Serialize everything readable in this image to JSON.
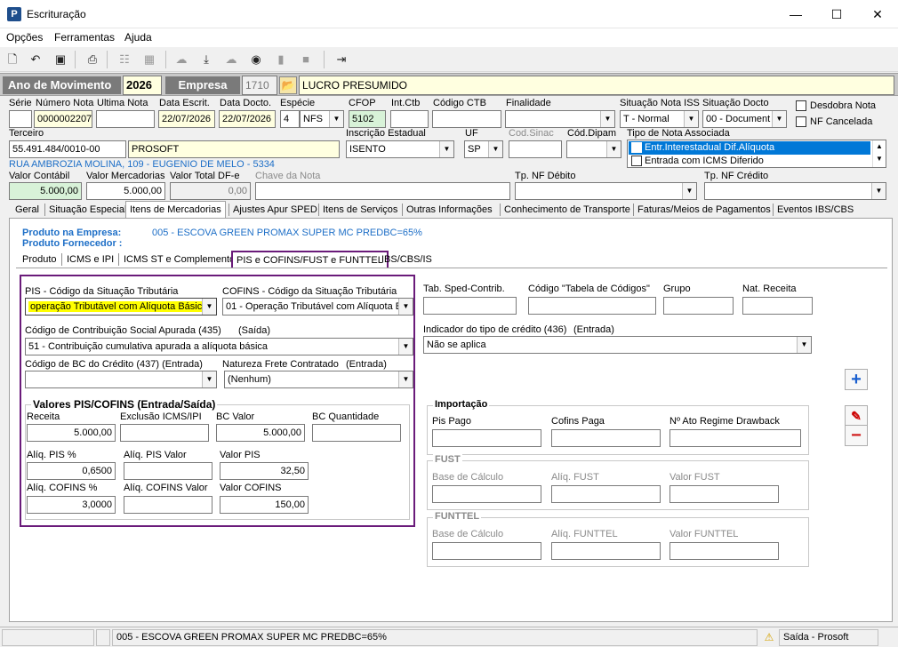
{
  "window": {
    "title": "Escrituração",
    "app_icon": "P",
    "minimize": "—",
    "maximize": "☐",
    "close": "✕"
  },
  "menu": [
    "Opções",
    "Ferramentas",
    "Ajuda"
  ],
  "header": {
    "ano_label": "Ano de Movimento",
    "ano_value": "2026",
    "empresa_label": "Empresa",
    "empresa_code": "1710",
    "empresa_name": "LUCRO PRESUMIDO"
  },
  "nota": {
    "serie_label": "Série",
    "serie": "",
    "numero_label": "Número Nota",
    "numero": "0000002207",
    "ultima_label": "Ultima Nota",
    "ultima": "",
    "data_escrit_label": "Data Escrit.",
    "data_escrit": "22/07/2026",
    "data_docto_label": "Data Docto.",
    "data_docto": "22/07/2026",
    "especie_label": "Espécie",
    "especie_num": "4",
    "especie": "NFS",
    "cfop_label": "CFOP",
    "cfop": "5102",
    "int_ctb_label": "Int.Ctb",
    "int_ctb": "",
    "codigo_ctb_label": "Código CTB",
    "codigo_ctb": "",
    "finalidade_label": "Finalidade",
    "finalidade": "",
    "sit_iss_label": "Situação Nota ISS",
    "sit_iss": "T - Normal",
    "sit_docto_label": "Situação Docto",
    "sit_docto": "00 - Document",
    "desdobra_label": "Desdobra Nota",
    "cancelada_label": "NF Cancelada",
    "terceiro_label": "Terceiro",
    "terceiro_cnpj": "55.491.484/0010-00",
    "terceiro_nome": "PROSOFT",
    "ie_label": "Inscrição Estadual",
    "ie": "ISENTO",
    "uf_label": "UF",
    "uf": "SP",
    "sinac_label": "Cod.Sinac",
    "sinac": "",
    "dipam_label": "Cód.Dipam",
    "dipam": "",
    "tipo_assoc_label": "Tipo de Nota Associada",
    "tipo_assoc_items": [
      "Entr.Interestadual Dif.Alíquota",
      "Entrada com ICMS Diferido"
    ],
    "endereco": "RUA AMBROZIA MOLINA, 109 - EUGENIO DE MELO - 5334",
    "valor_contabil_label": "Valor Contábil",
    "valor_contabil": "5.000,00",
    "valor_merc_label": "Valor Mercadorias",
    "valor_merc": "5.000,00",
    "valor_dfe_label": "Valor Total DF-e",
    "valor_dfe": "0,00",
    "chave_label": "Chave da Nota",
    "chave": "",
    "tp_debito_label": "Tp. NF Débito",
    "tp_debito": "",
    "tp_credito_label": "Tp. NF Crédito",
    "tp_credito": ""
  },
  "main_tabs": [
    "Geral",
    "Situação Especial",
    "Itens de Mercadorias",
    "Ajustes Apur SPED",
    "Itens de Serviços",
    "Outras Informações",
    "Conhecimento de Transporte",
    "Faturas/Meios de Pagamentos",
    "Eventos IBS/CBS"
  ],
  "produto": {
    "empresa_label": "Produto na Empresa:",
    "empresa_value": "005 - ESCOVA GREEN PROMAX SUPER MC PREDBC=65%",
    "fornecedor_label": "Produto Fornecedor :"
  },
  "sub_tabs": [
    "Produto",
    "ICMS e IPI",
    "ICMS ST e Complemento",
    "PIS e COFINS/FUST e FUNTTEL",
    "IBS/CBS/IS"
  ],
  "pis": {
    "cst_pis_label": "PIS - Código da Situação Tributária",
    "cst_pis": "operação Tributável com Alíquota Básica",
    "cst_cofins_label": "COFINS - Código da Situação Tributária",
    "cst_cofins": "01 - Operação Tributável com Alíquota B",
    "contrib_label": "Código de Contribuição Social Apurada (435)",
    "contrib_saida": "(Saída)",
    "contrib": "51 - Contribuição cumulativa apurada a alíquota básica",
    "bc_credito_label": "Código de BC do Crédito (437) (Entrada)",
    "bc_credito": "",
    "frete_label": "Natureza Frete Contratado",
    "frete_entrada": "(Entrada)",
    "frete": "(Nenhum)",
    "valores_title": "Valores PIS/COFINS (Entrada/Saída)",
    "receita_label": "Receita",
    "receita": "5.000,00",
    "exclusao_label": "Exclusão ICMS/IPI",
    "exclusao": "",
    "bc_valor_label": "BC Valor",
    "bc_valor": "5.000,00",
    "bc_qtd_label": "BC Quantidade",
    "bc_qtd": "",
    "aliq_pis_label": "Alíq. PIS %",
    "aliq_pis": "0,6500",
    "aliq_pis_valor_label": "Alíq. PIS Valor",
    "aliq_pis_valor": "",
    "valor_pis_label": "Valor PIS",
    "valor_pis": "32,50",
    "aliq_cofins_label": "Alíq. COFINS %",
    "aliq_cofins": "3,0000",
    "aliq_cofins_valor_label": "Alíq. COFINS Valor",
    "aliq_cofins_valor": "",
    "valor_cofins_label": "Valor COFINS",
    "valor_cofins": "150,00"
  },
  "sped": {
    "tab_sped_label": "Tab. Sped-Contrib.",
    "codigo_tabela_label": "Código \"Tabela de Códigos\"",
    "grupo_label": "Grupo",
    "nat_receita_label": "Nat. Receita",
    "indicador_label": "Indicador do tipo de crédito (436)",
    "indicador_entrada": "(Entrada)",
    "indicador": "Não se aplica"
  },
  "importacao": {
    "title": "Importação",
    "pis_pago_label": "Pis Pago",
    "cofins_paga_label": "Cofins Paga",
    "ato_label": "Nº Ato Regime Drawback"
  },
  "fust": {
    "title": "FUST",
    "base_label": "Base de Cálculo",
    "aliq_label": "Alíq. FUST",
    "valor_label": "Valor FUST"
  },
  "funttel": {
    "title": "FUNTTEL",
    "base_label": "Base de Cálculo",
    "aliq_label": "Alíq. FUNTTEL",
    "valor_label": "Valor FUNTTEL"
  },
  "status": {
    "item": "005 - ESCOVA GREEN PROMAX SUPER MC PREDBC=65%",
    "mode": "Saída - Prosoft"
  },
  "colors": {
    "accent_purple": "#6a1b7a",
    "highlight_yellow": "#ffff00",
    "selection_blue": "#0078d7"
  }
}
